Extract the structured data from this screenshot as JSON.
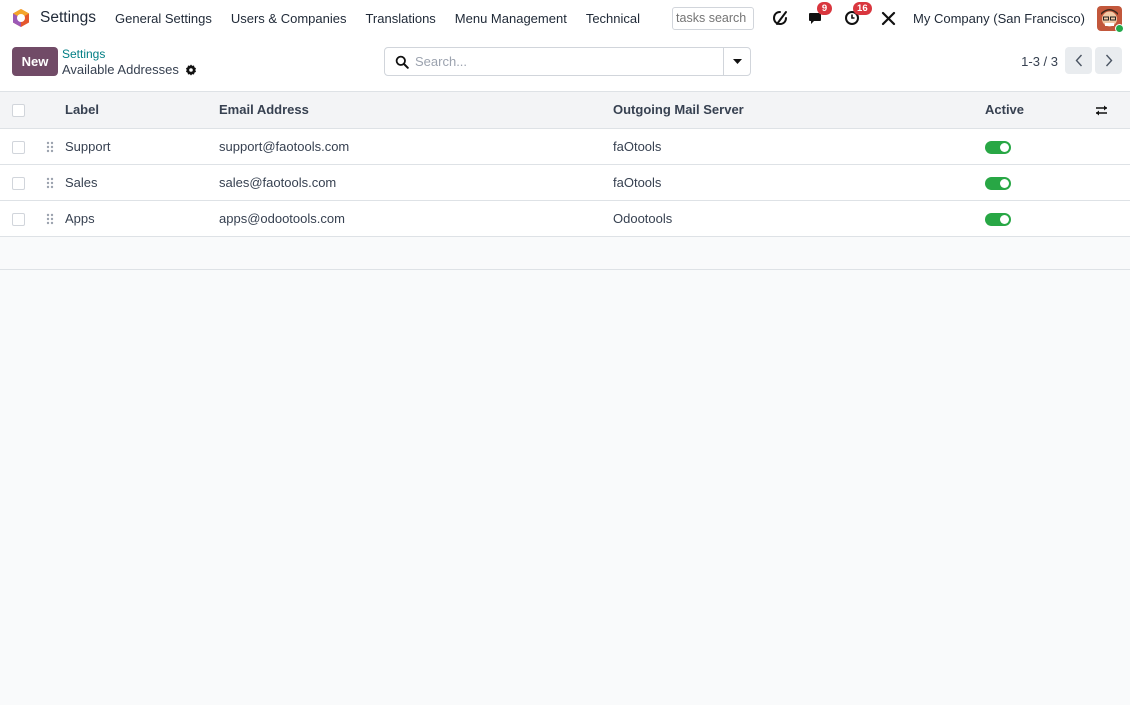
{
  "navbar": {
    "app_title": "Settings",
    "menu": [
      "General Settings",
      "Users & Companies",
      "Translations",
      "Menu Management",
      "Technical"
    ],
    "tasks_search_placeholder": "tasks search",
    "messages_badge": "9",
    "activities_badge": "16",
    "company": "My Company (San Francisco)",
    "icons": {
      "logo": "odoo-logo-icon",
      "discuss": "chat-icon",
      "activity": "clock-icon",
      "debug": "bug-icon",
      "tools": "tools-icon"
    },
    "colors": {
      "badge": "#d9363e",
      "online": "#22a94c"
    }
  },
  "control_panel": {
    "new_label": "New",
    "breadcrumb_parent": "Settings",
    "breadcrumb_current": "Available Addresses",
    "search_placeholder": "Search...",
    "pager": "1-3 / 3",
    "colors": {
      "primary": "#714b67",
      "link": "#017e84"
    }
  },
  "table": {
    "columns": [
      "Label",
      "Email Address",
      "Outgoing Mail Server",
      "Active"
    ],
    "rows": [
      {
        "label": "Support",
        "email": "support@faotools.com",
        "server": "faOtools",
        "active": true
      },
      {
        "label": "Sales",
        "email": "sales@faotools.com",
        "server": "faOtools",
        "active": true
      },
      {
        "label": "Apps",
        "email": "apps@odootools.com",
        "server": "Odootools",
        "active": true
      }
    ],
    "colors": {
      "toggle_on": "#28a745"
    }
  }
}
